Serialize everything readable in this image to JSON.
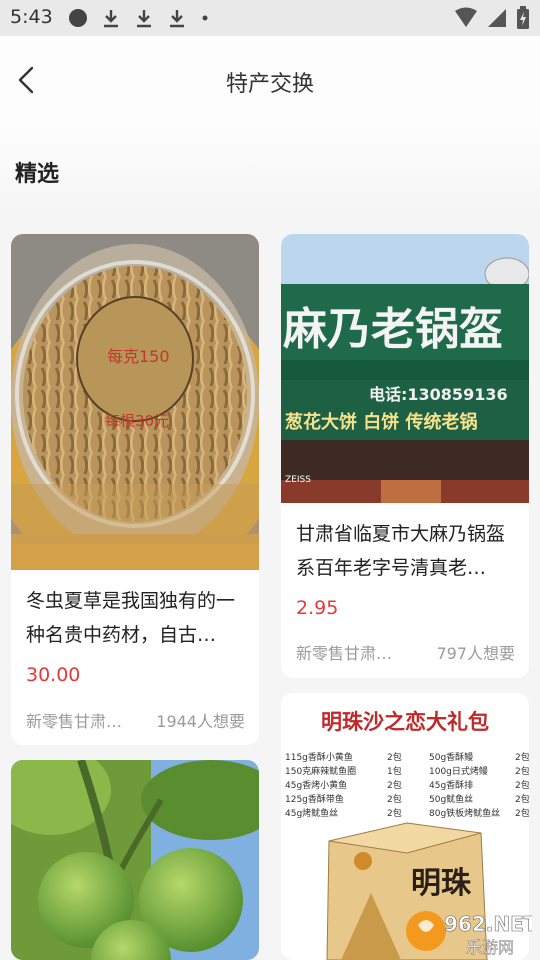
{
  "status": {
    "time": "5:43"
  },
  "nav": {
    "title": "特产交换"
  },
  "section": {
    "title": "精选"
  },
  "products": [
    {
      "image_text_1": "每克150",
      "image_text_2": "每根30元",
      "description": "冬虫夏草是我国独有的一种名贵中药材，自古…",
      "price": "30.00",
      "seller": "新零售甘肃…",
      "wants": "1944人想要"
    },
    {
      "sign_text": "麻乃老锅盔",
      "phone_text": "电话:130859136",
      "menu_text": "葱花大饼 白饼 传统老锅",
      "camera_text": "ZEISS",
      "description": "甘肃省临夏市大麻乃锅盔系百年老字号清真老…",
      "price": "2.95",
      "seller": "新零售甘肃…",
      "wants": "797人想要"
    },
    {
      "image": "walnuts"
    },
    {
      "banner_title": "明珠沙之恋大礼包",
      "list_left": [
        "115g香酥小黄鱼",
        "150克麻辣鱿鱼圈",
        "45g香烤小黄鱼",
        "125g香酥带鱼",
        "45g烤鱿鱼丝"
      ],
      "qty_left": [
        "2包",
        "1包",
        "2包",
        "2包",
        "2包"
      ],
      "list_right": [
        "50g香酥鳗",
        "100g日式烤鳗",
        "45g香酥排",
        "50g鱿鱼丝",
        "80g铁板烤鱿鱼丝"
      ],
      "qty_right": [
        "2包",
        "2包",
        "2包",
        "2包",
        "2包"
      ],
      "box_text": "明珠"
    }
  ],
  "watermark": {
    "top": "962.NET",
    "bottom": "乐游网"
  }
}
